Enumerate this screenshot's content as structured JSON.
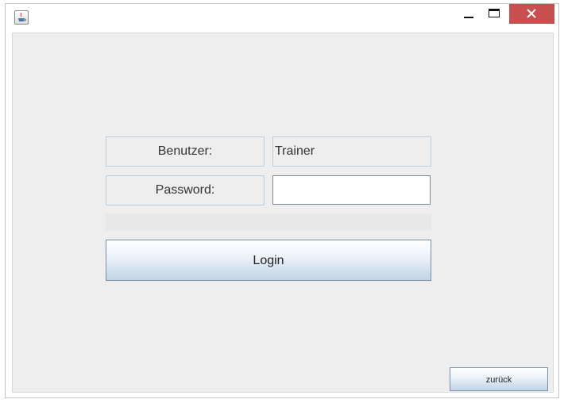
{
  "window": {
    "title": "",
    "icons": {
      "app": "java-cup-icon",
      "minimize": "minimize-icon",
      "maximize": "maximize-icon",
      "close": "close-icon"
    },
    "colors": {
      "close_button": "#c7504e",
      "panel_background": "#eeeeee",
      "field_border": "#b9cfe0"
    }
  },
  "form": {
    "user_label": "Benutzer:",
    "user_value": "Trainer",
    "password_label": "Password:",
    "password_value": "",
    "status_text": "",
    "login_label": "Login"
  },
  "footer": {
    "back_label": "zurück"
  }
}
